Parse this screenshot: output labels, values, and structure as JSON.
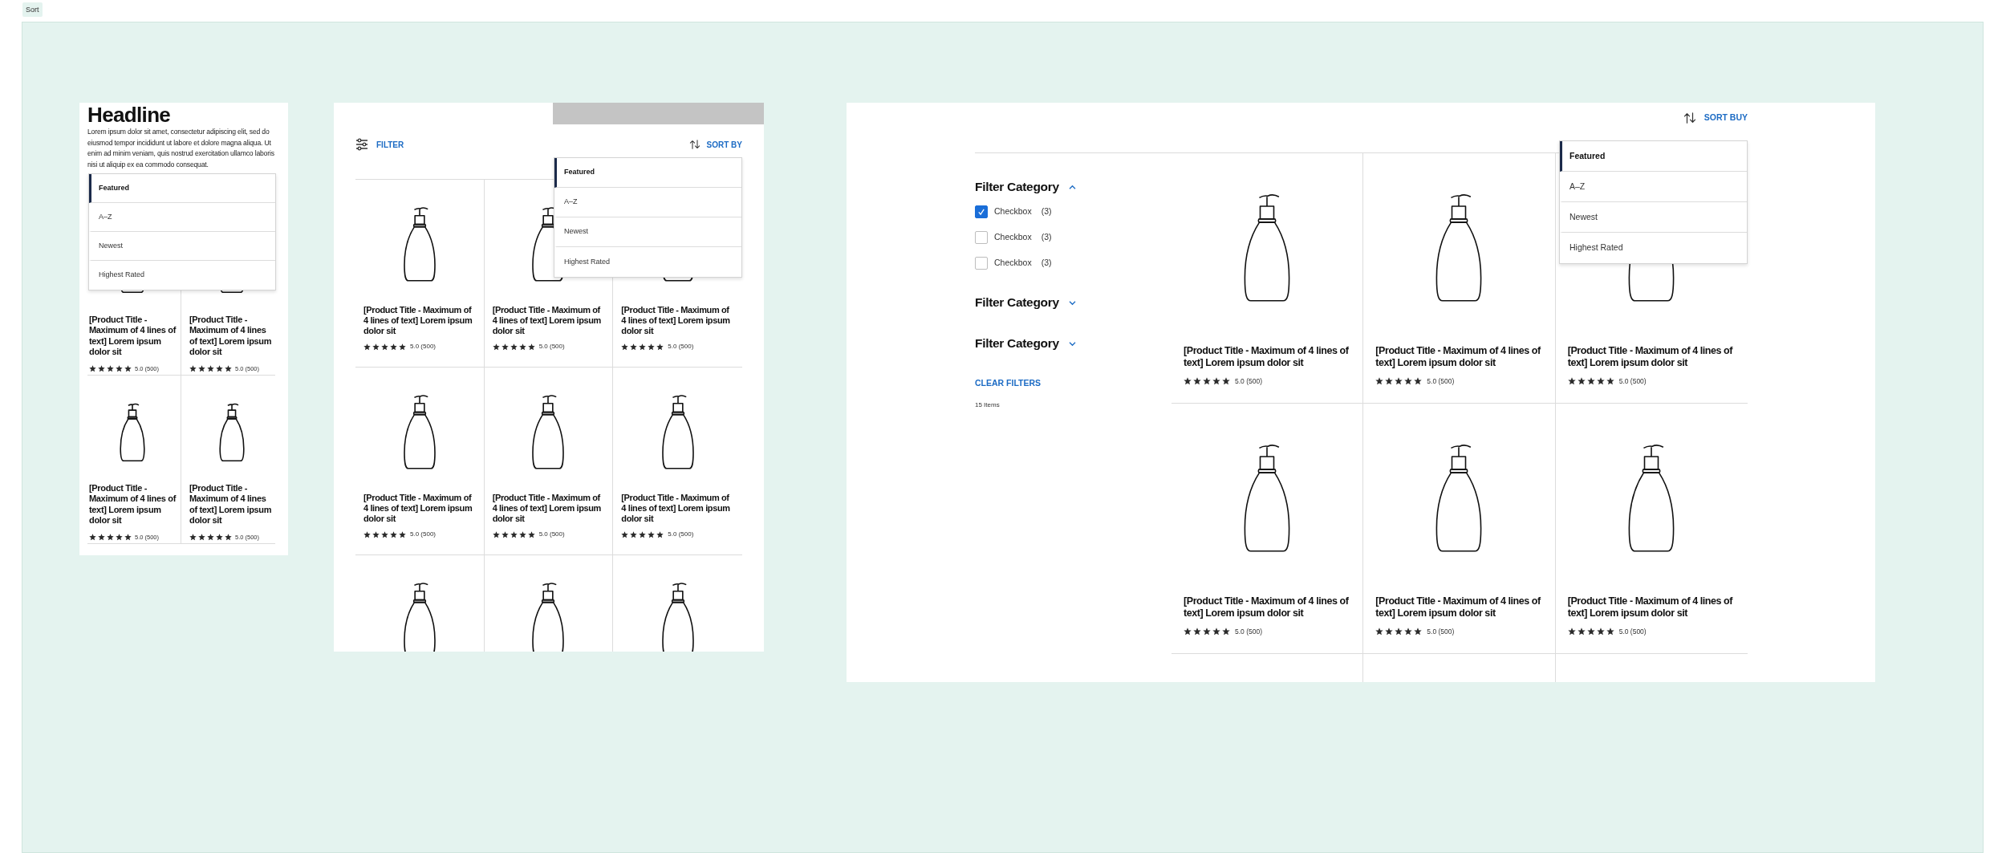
{
  "canvas_label": "Sort",
  "mobile": {
    "headline": "Headline",
    "body": "Lorem ipsum dolor sit amet, consectetur adipiscing elit, sed do eiusmod tempor incididunt ut labore et dolore magna aliqua. Ut enim ad minim veniam, quis nostrud exercitation ullamco laboris nisi ut aliquip ex ea commodo consequat.",
    "sort_options": [
      {
        "label": "Featured",
        "selected": true
      },
      {
        "label": "A–Z",
        "selected": false
      },
      {
        "label": "Newest",
        "selected": false
      },
      {
        "label": "Highest Rated",
        "selected": false
      }
    ],
    "products": [
      {
        "kind": "full",
        "title": "[Product Title - Maximum of 4 lines of text] Lorem ipsum dolor sit",
        "stars": 5,
        "rating": "5.0 (500)"
      },
      {
        "kind": "full",
        "title": "[Product Title - Maximum of 4 lines of text] Lorem ipsum dolor sit",
        "stars": 5,
        "rating": "5.0 (500)"
      },
      {
        "kind": "full",
        "title": "[Product Title - Maximum of 4 lines of text] Lorem ipsum dolor sit",
        "stars": 5,
        "rating": "5.0 (500)"
      },
      {
        "kind": "full",
        "title": "[Product Title - Maximum of 4 lines of text] Lorem ipsum dolor sit",
        "stars": 5,
        "rating": "5.0 (500)"
      }
    ]
  },
  "tablet": {
    "filter_label": "FILTER",
    "sort_label": "SORT BY",
    "sort_options": [
      {
        "label": "Featured",
        "selected": true
      },
      {
        "label": "A–Z",
        "selected": false
      },
      {
        "label": "Newest",
        "selected": false
      },
      {
        "label": "Highest Rated",
        "selected": false
      }
    ],
    "products": [
      {
        "kind": "full",
        "title": "[Product Title - Maximum of 4 lines of text] Lorem ipsum dolor sit",
        "stars": 5,
        "rating": "5.0 (500)"
      },
      {
        "kind": "full",
        "title": "[Product Title - Maximum of 4 lines of text] Lorem ipsum dolor sit",
        "stars": 5,
        "rating": "5.0 (500)"
      },
      {
        "kind": "full",
        "title": "[Product Title - Maximum of 4 lines of text] Lorem ipsum dolor sit",
        "stars": 5,
        "rating": "5.0 (500)"
      },
      {
        "kind": "full",
        "title": "[Product Title - Maximum of 4 lines of text] Lorem ipsum dolor sit",
        "stars": 5,
        "rating": "5.0 (500)"
      },
      {
        "kind": "full",
        "title": "[Product Title - Maximum of 4 lines of text] Lorem ipsum dolor sit",
        "stars": 5,
        "rating": "5.0 (500)"
      },
      {
        "kind": "full",
        "title": "[Product Title - Maximum of 4 lines of text] Lorem ipsum dolor sit",
        "stars": 5,
        "rating": "5.0 (500)"
      },
      {
        "kind": "image_only"
      },
      {
        "kind": "image_only"
      },
      {
        "kind": "image_only"
      }
    ]
  },
  "desktop": {
    "sort_label": "SORT BUY",
    "filter_groups": [
      {
        "title": "Filter Category",
        "expanded": true,
        "options": [
          {
            "label": "Checkbox",
            "count": "(3)",
            "checked": true
          },
          {
            "label": "Checkbox",
            "count": "(3)",
            "checked": false
          },
          {
            "label": "Checkbox",
            "count": "(3)",
            "checked": false
          }
        ]
      },
      {
        "title": "Filter Category",
        "expanded": false
      },
      {
        "title": "Filter Category",
        "expanded": false
      }
    ],
    "clear_filters": "CLEAR FILTERS",
    "item_count": "15 Items",
    "sort_options": [
      {
        "label": "Featured",
        "selected": true
      },
      {
        "label": "A–Z",
        "selected": false
      },
      {
        "label": "Newest",
        "selected": false
      },
      {
        "label": "Highest Rated",
        "selected": false
      }
    ],
    "products": [
      {
        "kind": "full",
        "title": "[Product Title - Maximum of 4 lines of text] Lorem ipsum dolor sit",
        "stars": 5,
        "rating": "5.0 (500)"
      },
      {
        "kind": "full",
        "title": "[Product Title - Maximum of 4 lines of text] Lorem ipsum dolor sit",
        "stars": 5,
        "rating": "5.0 (500)"
      },
      {
        "kind": "full",
        "title": "[Product Title - Maximum of 4 lines of text] Lorem ipsum dolor sit",
        "stars": 5,
        "rating": "5.0 (500)"
      },
      {
        "kind": "full",
        "title": "[Product Title - Maximum of 4 lines of text] Lorem ipsum dolor sit",
        "stars": 5,
        "rating": "5.0 (500)"
      },
      {
        "kind": "full",
        "title": "[Product Title - Maximum of 4 lines of text] Lorem ipsum dolor sit",
        "stars": 5,
        "rating": "5.0 (500)"
      },
      {
        "kind": "full",
        "title": "[Product Title - Maximum of 4 lines of text] Lorem ipsum dolor sit",
        "stars": 5,
        "rating": "5.0 (500)"
      }
    ]
  }
}
